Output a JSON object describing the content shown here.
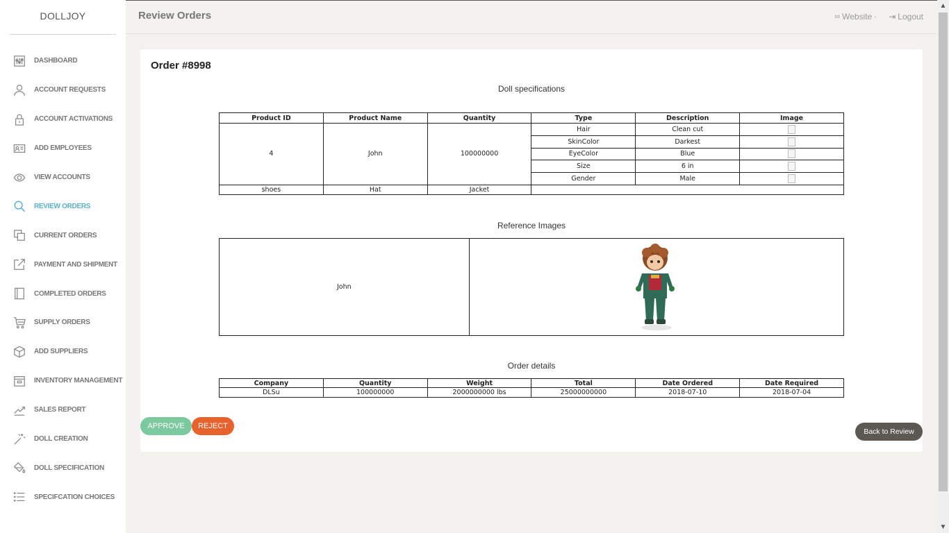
{
  "brand": "DOLLJOY",
  "header": {
    "title": "Review Orders",
    "website_label": "Website",
    "website_caret": "-",
    "logout_label": "Logout"
  },
  "sidebar": {
    "items": [
      {
        "label": "DASHBOARD",
        "icon": "dashboard-icon"
      },
      {
        "label": "ACCOUNT REQUESTS",
        "icon": "user-icon"
      },
      {
        "label": "ACCOUNT ACTIVATIONS",
        "icon": "lock-icon"
      },
      {
        "label": "ADD EMPLOYEES",
        "icon": "id-card-icon"
      },
      {
        "label": "VIEW ACCOUNTS",
        "icon": "eye-icon"
      },
      {
        "label": "REVIEW ORDERS",
        "icon": "search-icon"
      },
      {
        "label": "CURRENT ORDERS",
        "icon": "copy-icon"
      },
      {
        "label": "PAYMENT AND SHIPMENT",
        "icon": "external-link-icon"
      },
      {
        "label": "COMPLETED ORDERS",
        "icon": "book-icon"
      },
      {
        "label": "SUPPLY ORDERS",
        "icon": "cart-icon"
      },
      {
        "label": "ADD SUPPLIERS",
        "icon": "box-icon"
      },
      {
        "label": "INVENTORY MANAGEMENT",
        "icon": "inventory-icon"
      },
      {
        "label": "SALES REPORT",
        "icon": "trend-icon"
      },
      {
        "label": "DOLL CREATION",
        "icon": "magic-wand-icon"
      },
      {
        "label": "DOLL SPECIFICATION",
        "icon": "paint-bucket-icon"
      },
      {
        "label": "SPECIFCATION CHOICES",
        "icon": "list-icon"
      }
    ]
  },
  "order": {
    "title": "Order #8998",
    "spec_title": "Doll specifications",
    "spec_headers": [
      "Product ID",
      "Product Name",
      "Quantity",
      "Type",
      "Description",
      "Image"
    ],
    "product_id": "4",
    "product_name": "John",
    "quantity": "100000000",
    "specs": [
      {
        "type": "Hair",
        "description": "Clean cut"
      },
      {
        "type": "SkinColor",
        "description": "Darkest"
      },
      {
        "type": "EyeColor",
        "description": "Blue"
      },
      {
        "type": "Size",
        "description": "6 in"
      },
      {
        "type": "Gender",
        "description": "Male"
      }
    ],
    "extras": [
      "shoes",
      "Hat",
      "Jacket"
    ],
    "ref_title": "Reference Images",
    "ref_name": "John",
    "details_title": "Order details",
    "details_headers": [
      "Company",
      "Quantity",
      "Weight",
      "Total",
      "Date Ordered",
      "Date Required"
    ],
    "details_row": [
      "DLSu",
      "100000000",
      "2000000000 lbs",
      "25000000000",
      "2018-07-10",
      "2018-07-04"
    ]
  },
  "buttons": {
    "approve": "APPROVE",
    "reject": "REJECT",
    "back": "Back to Review"
  },
  "colors": {
    "accent": "#5ab0c8",
    "approve": "#7cc9a0",
    "reject": "#e8622d",
    "back": "#5c5955"
  },
  "active_nav": "REVIEW ORDERS"
}
